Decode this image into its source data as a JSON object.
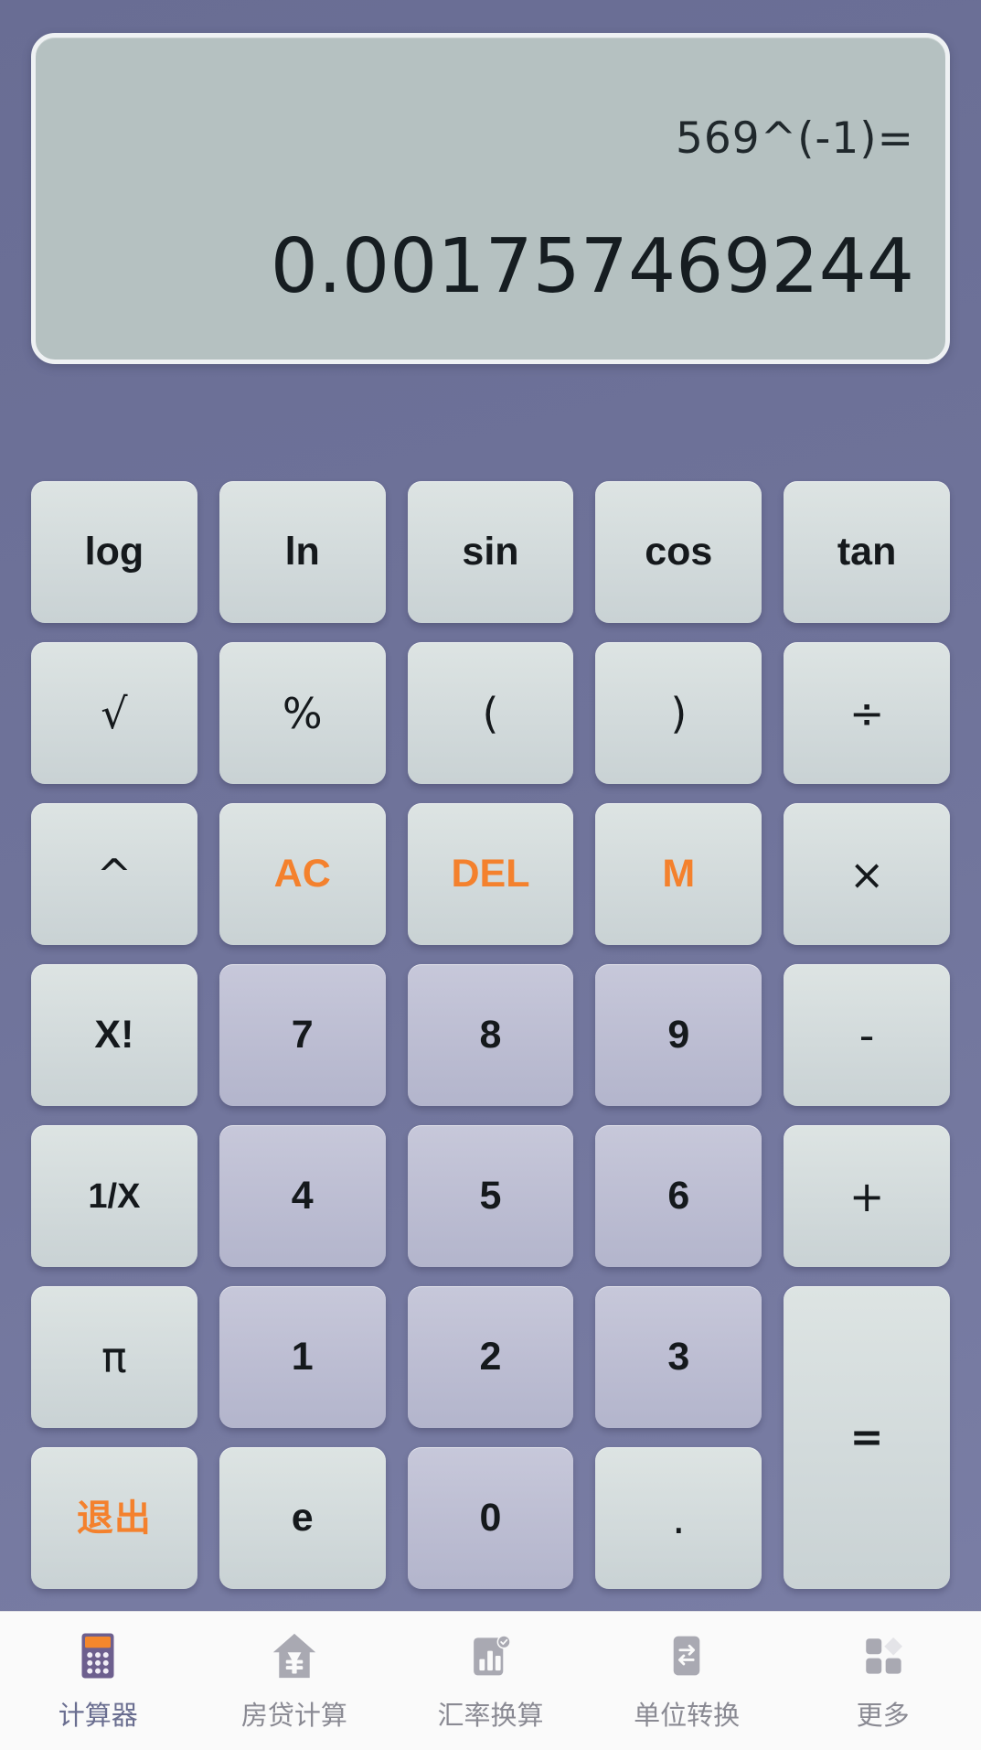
{
  "app": {
    "name": "计算器"
  },
  "theme": {
    "background": "#6f739a",
    "display_bg": "#b5c1c1",
    "func_key": "#d2dadb",
    "digit_key": "#bcbdd2",
    "accent": "#f4812d",
    "text": "#15191c",
    "nav_bg": "#fafafa",
    "nav_label": "#8a8a93",
    "nav_label_active": "#6a6e90"
  },
  "display": {
    "expression": "569^(-1)=",
    "result": "0.001757469244"
  },
  "keys": [
    {
      "label": "log",
      "name": "key-log",
      "style": "func"
    },
    {
      "label": "ln",
      "name": "key-ln",
      "style": "func"
    },
    {
      "label": "sin",
      "name": "key-sin",
      "style": "func"
    },
    {
      "label": "cos",
      "name": "key-cos",
      "style": "func"
    },
    {
      "label": "tan",
      "name": "key-tan",
      "style": "func"
    },
    {
      "label": "√",
      "name": "key-sqrt",
      "style": "sym"
    },
    {
      "label": "%",
      "name": "key-percent",
      "style": "sym"
    },
    {
      "label": "(",
      "name": "key-paren-open",
      "style": "sym"
    },
    {
      "label": ")",
      "name": "key-paren-close",
      "style": "sym"
    },
    {
      "label": "÷",
      "name": "key-divide",
      "style": "sym"
    },
    {
      "label": "^",
      "name": "key-power",
      "style": "sym"
    },
    {
      "label": "AC",
      "name": "key-all-clear",
      "style": "accent"
    },
    {
      "label": "DEL",
      "name": "key-delete",
      "style": "accent"
    },
    {
      "label": "M",
      "name": "key-memory",
      "style": "accent"
    },
    {
      "label": "×",
      "name": "key-multiply",
      "style": "sym"
    },
    {
      "label": "X!",
      "name": "key-factorial",
      "style": "func"
    },
    {
      "label": "7",
      "name": "key-7",
      "style": "digit"
    },
    {
      "label": "8",
      "name": "key-8",
      "style": "digit"
    },
    {
      "label": "9",
      "name": "key-9",
      "style": "digit"
    },
    {
      "label": "-",
      "name": "key-minus",
      "style": "sym"
    },
    {
      "label": "1/X",
      "name": "key-reciprocal",
      "style": "small"
    },
    {
      "label": "4",
      "name": "key-4",
      "style": "digit"
    },
    {
      "label": "5",
      "name": "key-5",
      "style": "digit"
    },
    {
      "label": "6",
      "name": "key-6",
      "style": "digit"
    },
    {
      "label": "+",
      "name": "key-plus",
      "style": "sym"
    },
    {
      "label": "π",
      "name": "key-pi",
      "style": "sym"
    },
    {
      "label": "1",
      "name": "key-1",
      "style": "digit"
    },
    {
      "label": "2",
      "name": "key-2",
      "style": "digit"
    },
    {
      "label": "3",
      "name": "key-3",
      "style": "digit"
    },
    {
      "label": "=",
      "name": "key-equals",
      "style": "eq"
    },
    {
      "label": "退出",
      "name": "key-exit",
      "style": "accent-cn"
    },
    {
      "label": "e",
      "name": "key-e",
      "style": "func"
    },
    {
      "label": "0",
      "name": "key-0",
      "style": "digit"
    },
    {
      "label": ".",
      "name": "key-decimal",
      "style": "sym"
    }
  ],
  "nav": {
    "items": [
      {
        "label": "计算器",
        "icon": "calculator-icon",
        "name": "nav-calculator",
        "active": true
      },
      {
        "label": "房贷计算",
        "icon": "house-yen-icon",
        "name": "nav-mortgage",
        "active": false
      },
      {
        "label": "汇率换算",
        "icon": "bar-chart-icon",
        "name": "nav-exchange-rate",
        "active": false
      },
      {
        "label": "单位转换",
        "icon": "swap-arrows-icon",
        "name": "nav-unit-conversion",
        "active": false
      },
      {
        "label": "更多",
        "icon": "grid-more-icon",
        "name": "nav-more",
        "active": false
      }
    ]
  }
}
